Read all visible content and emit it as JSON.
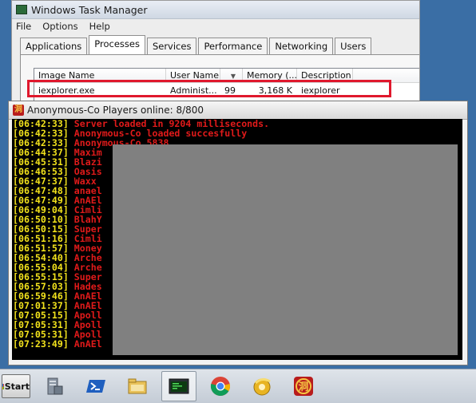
{
  "taskmgr": {
    "title": "Windows Task Manager",
    "menu": [
      "File",
      "Options",
      "Help"
    ],
    "tabs": [
      "Applications",
      "Processes",
      "Services",
      "Performance",
      "Networking",
      "Users"
    ],
    "active_tab": "Processes",
    "columns": [
      "Image Name",
      "User Name",
      "",
      "Memory (...",
      "Description"
    ],
    "row": {
      "image": "iexplorer.exe",
      "user": "Administ...",
      "cpu": "99",
      "memory": "3,168 K",
      "description": "iexplorer"
    }
  },
  "console": {
    "title": "Anonymous-Co Players online: 8/800",
    "lines": [
      {
        "ts": "[06:42:33]",
        "msg": " Server loaded in 9204 milliseconds."
      },
      {
        "ts": "[06:42:33]",
        "msg": " Anonymous-Co loaded succesfully"
      },
      {
        "ts": "[06:42:33]",
        "msg": " Anonymous-Co 5838"
      },
      {
        "ts": "[06:44:37]",
        "msg": " Maxim"
      },
      {
        "ts": "[06:45:31]",
        "msg": " Blazi"
      },
      {
        "ts": "[06:46:53]",
        "msg": " Oasis"
      },
      {
        "ts": "[06:47:37]",
        "msg": " Waxx"
      },
      {
        "ts": "[06:47:48]",
        "msg": " anael"
      },
      {
        "ts": "[06:47:49]",
        "msg": " AnAEl"
      },
      {
        "ts": "[06:49:04]",
        "msg": " Cimli"
      },
      {
        "ts": "[06:50:10]",
        "msg": " BlahY"
      },
      {
        "ts": "[06:50:15]",
        "msg": " Super"
      },
      {
        "ts": "[06:51:16]",
        "msg": " Cimli"
      },
      {
        "ts": "[06:51:57]",
        "msg": " Money"
      },
      {
        "ts": "[06:54:40]",
        "msg": " Arche"
      },
      {
        "ts": "[06:55:04]",
        "msg": " Arche"
      },
      {
        "ts": "[06:55:15]",
        "msg": " Super"
      },
      {
        "ts": "[06:57:03]",
        "msg": " Hades"
      },
      {
        "ts": "[06:59:46]",
        "msg": " AnAEl"
      },
      {
        "ts": "[07:01:37]",
        "msg": " AnAEl"
      },
      {
        "ts": "[07:05:15]",
        "msg": " Apoll"
      },
      {
        "ts": "[07:05:31]",
        "msg": " Apoll"
      },
      {
        "ts": "[07:05:31]",
        "msg": " Apoll"
      },
      {
        "ts": "[07:23:49]",
        "msg": " AnAEl"
      }
    ]
  },
  "taskbar": {
    "start_label": "Start",
    "items": [
      "server-manager-icon",
      "powershell-icon",
      "file-explorer-icon",
      "console-app-icon",
      "chrome-icon",
      "browser-gold-icon",
      "game-server-icon"
    ]
  },
  "colors": {
    "desktop": "#3a6ea5",
    "console_timestamp": "#f2e21c",
    "console_message": "#e01a1a",
    "highlight": "#e0182d",
    "redaction": "#808080"
  }
}
